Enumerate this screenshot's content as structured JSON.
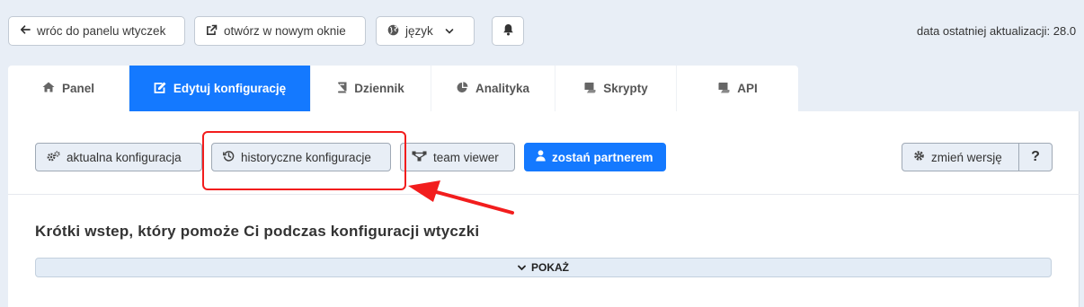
{
  "topbar": {
    "back_label": "wróc do panelu wtyczek",
    "open_window_label": "otwórz w nowym oknie",
    "language_label": "język",
    "last_update": "data ostatniej aktualizacji: 28.0"
  },
  "tabs": [
    {
      "label": "Panel",
      "icon": "home-icon"
    },
    {
      "label": "Edytuj konfigurację",
      "icon": "edit-icon"
    },
    {
      "label": "Dziennik",
      "icon": "book-icon"
    },
    {
      "label": "Analityka",
      "icon": "pie-chart-icon"
    },
    {
      "label": "Skrypty",
      "icon": "scroll-icon"
    },
    {
      "label": "API",
      "icon": "scroll-icon"
    }
  ],
  "toolbar": {
    "current_config": "aktualna konfiguracja",
    "history_config": "historyczne konfiguracje",
    "team_viewer": "team viewer",
    "partner": "zostań partnerem",
    "change_version": "zmień wersję",
    "help": "?"
  },
  "intro": {
    "title": "Krótki wstep, który pomoże Ci podczas konfiguracji wtyczki",
    "show_label": "POKAŻ"
  },
  "colors": {
    "accent": "#1479ff",
    "annotation": "#f21d1d"
  }
}
